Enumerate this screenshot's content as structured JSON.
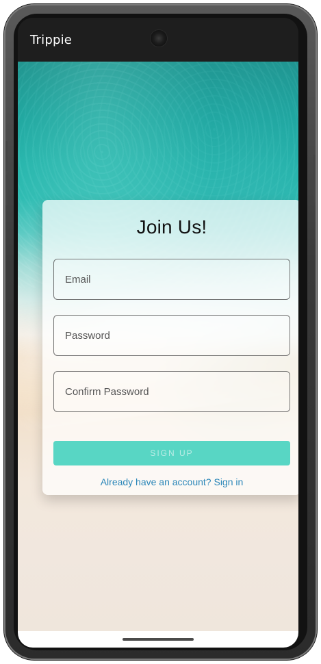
{
  "app": {
    "title": "Trippie"
  },
  "form": {
    "title": "Join Us!",
    "email": {
      "placeholder": "Email",
      "value": ""
    },
    "password": {
      "placeholder": "Password",
      "value": ""
    },
    "confirm_password": {
      "placeholder": "Confirm Password",
      "value": ""
    },
    "signup_button_label": "SIGN UP",
    "signin_link_text": "Already have an account? Sign in"
  },
  "colors": {
    "accent": "#58d6c4",
    "link": "#2a86b8"
  }
}
